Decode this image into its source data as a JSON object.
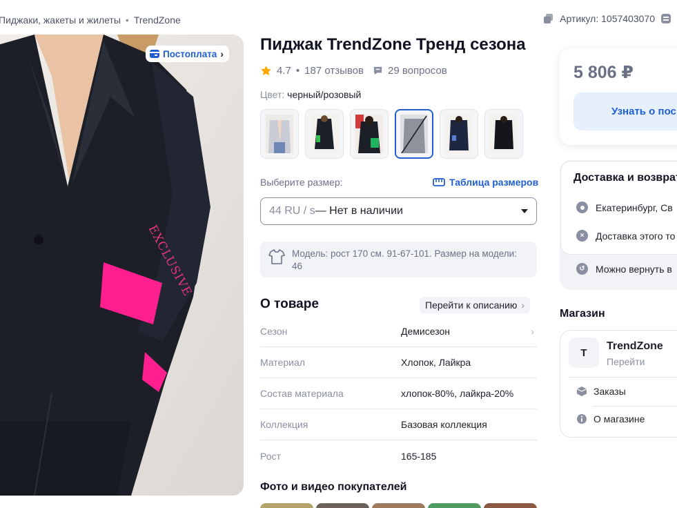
{
  "breadcrumb": {
    "category": "Пиджаки, жакеты и жилеты",
    "separator": "•",
    "brand": "TrendZone"
  },
  "sku": {
    "label": "Артикул: 1057403070"
  },
  "gallery": {
    "badge": "Постоплата",
    "badge_chevron": "›"
  },
  "product": {
    "title": "Пиджак TrendZone Тренд сезона",
    "rating": "4.7",
    "dot": "•",
    "reviews": "187 отзывов",
    "questions": "29 вопросов",
    "color_label": "Цвет:",
    "color_value": "черный/розовый"
  },
  "thumbnails": [
    {
      "selected": false
    },
    {
      "selected": false
    },
    {
      "selected": false
    },
    {
      "selected": true
    },
    {
      "selected": false
    },
    {
      "selected": false
    }
  ],
  "size": {
    "label": "Выберите размер:",
    "table_link": "Таблица размеров",
    "selected_size": "44 RU / s",
    "availability": " — Нет в наличии",
    "model_info": "Модель: рост 170 см. 91-67-101. Размер на модели: 46"
  },
  "about": {
    "title": "О товаре",
    "link": "Перейти к описанию",
    "specs": [
      {
        "key": "Сезон",
        "value": "Демисезон"
      },
      {
        "key": "Материал",
        "value": "Хлопок, Лайкра"
      },
      {
        "key": "Состав материала",
        "value": "хлопок-80%, лайкра-20%"
      },
      {
        "key": "Коллекция",
        "value": "Базовая коллекция"
      },
      {
        "key": "Рост",
        "value": "165-185"
      }
    ]
  },
  "ugc": {
    "title": "Фото и видео покупателей"
  },
  "price_card": {
    "price": "5 806 ₽",
    "notify_button": "Узнать о пос"
  },
  "delivery": {
    "title": "Доставка и возврат",
    "location": "Екатеринбург, Св",
    "restriction": "Доставка этого то",
    "returns": "Можно вернуть в"
  },
  "store": {
    "section_title": "Магазин",
    "avatar_letter": "T",
    "name": "TrendZone",
    "go": "Перейти",
    "orders": "Заказы",
    "about": "О магазине"
  },
  "colors": {
    "accent": "#1f5fd1",
    "sale_pink": "#ff1f8e",
    "jacket": "#1c1f27"
  }
}
